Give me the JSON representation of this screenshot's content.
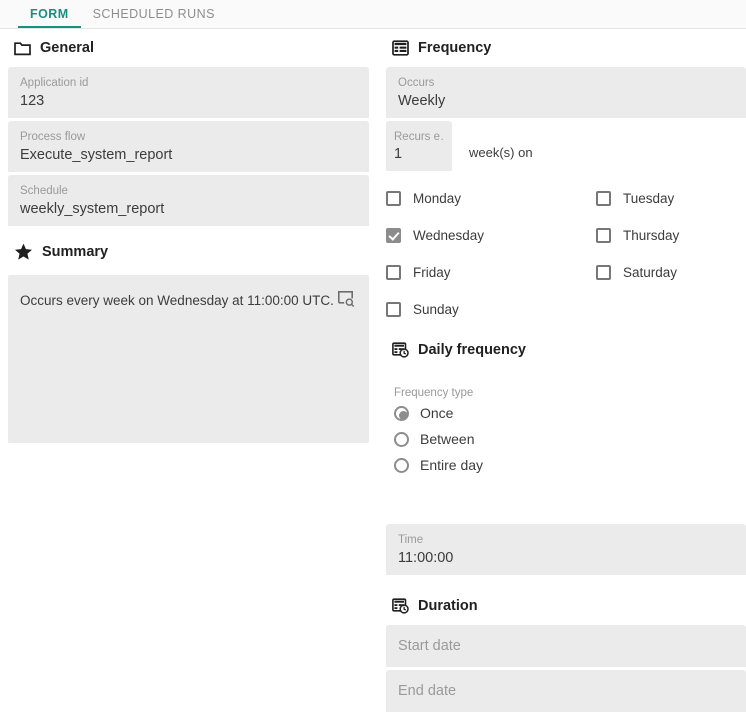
{
  "tabs": [
    {
      "label": "FORM",
      "active": true
    },
    {
      "label": "SCHEDULED RUNS",
      "active": false
    }
  ],
  "left": {
    "general": {
      "heading": "General",
      "icon": "folder-icon",
      "fields": [
        {
          "label": "Application id",
          "value": "123"
        },
        {
          "label": "Process flow",
          "value": "Execute_system_report"
        },
        {
          "label": "Schedule",
          "value": "weekly_system_report"
        }
      ]
    },
    "summary": {
      "heading": "Summary",
      "icon": "star-icon",
      "text": "Occurs every week on Wednesday at 11:00:00 UTC.",
      "action_icon": "preview-search-icon"
    }
  },
  "right": {
    "frequency": {
      "heading": "Frequency",
      "icon": "table-icon",
      "occurs": {
        "label": "Occurs",
        "value": "Weekly"
      },
      "recurs": {
        "label": "Recurs e…",
        "value": "1",
        "suffix": "week(s) on"
      },
      "days": [
        {
          "label": "Monday",
          "checked": false
        },
        {
          "label": "Tuesday",
          "checked": false
        },
        {
          "label": "Wednesday",
          "checked": true
        },
        {
          "label": "Thursday",
          "checked": false
        },
        {
          "label": "Friday",
          "checked": false
        },
        {
          "label": "Saturday",
          "checked": false
        },
        {
          "label": "Sunday",
          "checked": false
        }
      ]
    },
    "daily_frequency": {
      "heading": "Daily frequency",
      "icon": "schedule-clock-icon",
      "type_label": "Frequency type",
      "options": [
        {
          "label": "Once",
          "selected": true
        },
        {
          "label": "Between",
          "selected": false
        },
        {
          "label": "Entire day",
          "selected": false
        }
      ]
    },
    "time": {
      "label": "Time",
      "value": "11:00:00"
    },
    "duration": {
      "heading": "Duration",
      "icon": "schedule-clock-icon",
      "fields": [
        {
          "placeholder": "Start date",
          "value": ""
        },
        {
          "placeholder": "End date",
          "value": ""
        }
      ]
    }
  },
  "colors": {
    "accent": "#18907f",
    "field_bg": "#ebebeb",
    "text": "#3c3c3c",
    "muted": "#9a9a9a"
  }
}
